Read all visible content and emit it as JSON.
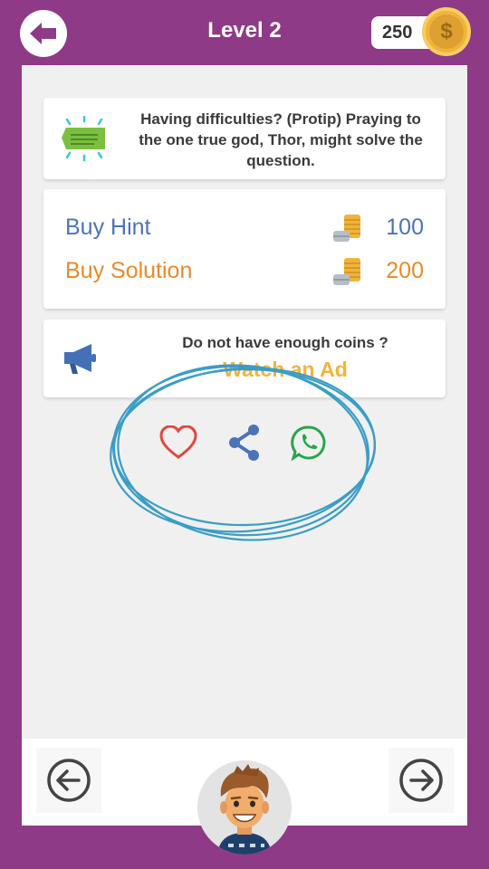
{
  "header": {
    "title": "Level 2",
    "coins": "250",
    "coin_symbol": "$"
  },
  "tip": {
    "text": "Having difficulties? (Protip) Praying to the one true god, Thor, might solve the question."
  },
  "buy": {
    "hint_label": "Buy Hint",
    "hint_price": "100",
    "solution_label": "Buy Solution",
    "solution_price": "200"
  },
  "ad": {
    "question": "Do not have enough coins ?",
    "link": "Watch an Ad"
  },
  "social": [
    "heart-icon",
    "share-icon",
    "whatsapp-icon"
  ],
  "colors": {
    "background": "#8e3a87",
    "hint": "#4a74b8",
    "solution": "#e98a2a",
    "ad_link": "#f3b33d",
    "heart": "#e2473f",
    "share": "#4a74b8",
    "whatsapp": "#27a54a",
    "scribble": "#3a9dc6"
  }
}
